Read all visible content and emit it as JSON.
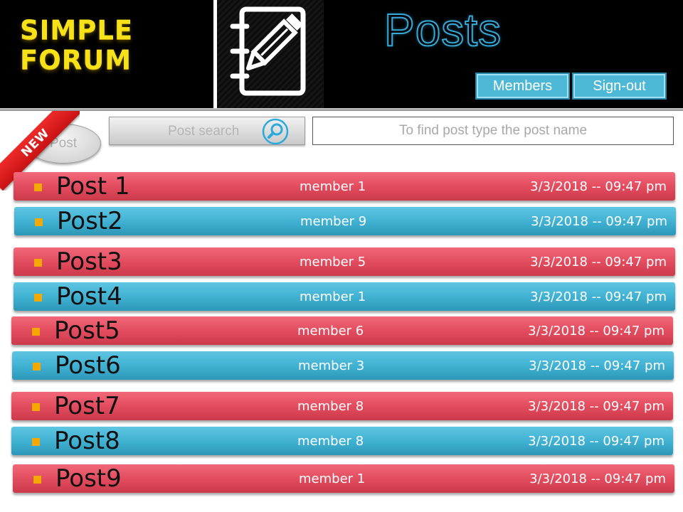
{
  "header": {
    "logo_line1": "SIMPLE",
    "logo_line2": "FORUM",
    "page_title": "Posts",
    "members_label": "Members",
    "signout_label": "Sign-out"
  },
  "toolbar": {
    "new_badge": "NEW",
    "new_post_label": "Post",
    "search_button_label": "Post search",
    "search_placeholder": "To find post type the post name"
  },
  "posts": [
    {
      "title": "Post 1",
      "member": "member 1",
      "date": "3/3/2018 -- 09:47 pm",
      "color": "red"
    },
    {
      "title": "Post2",
      "member": "member 9",
      "date": "3/3/2018 -- 09:47 pm",
      "color": "blue"
    },
    {
      "title": "Post3",
      "member": "member 5",
      "date": "3/3/2018 -- 09:47 pm",
      "color": "red"
    },
    {
      "title": "Post4",
      "member": "member 1",
      "date": "3/3/2018 -- 09:47 pm",
      "color": "blue"
    },
    {
      "title": "Post5",
      "member": "member 6",
      "date": "3/3/2018 -- 09:47 pm",
      "color": "red"
    },
    {
      "title": "Post6",
      "member": "member 3",
      "date": "3/3/2018 -- 09:47 pm",
      "color": "blue"
    },
    {
      "title": "Post7",
      "member": "member 8",
      "date": "3/3/2018 -- 09:47 pm",
      "color": "red"
    },
    {
      "title": "Post8",
      "member": "member 8",
      "date": "3/3/2018 -- 09:47 pm",
      "color": "blue"
    },
    {
      "title": "Post9",
      "member": "member 1",
      "date": "3/3/2018 -- 09:47 pm",
      "color": "red"
    }
  ],
  "icons": {
    "header_icon": "notebook-pencil-icon",
    "search_icon": "magnifier-icon",
    "bullet_icon": "square-bullet-icon"
  },
  "colors": {
    "logo_yellow": "#f7e21a",
    "title_outline": "#37a9d8",
    "nav_button": "#4db8d6",
    "row_red": "#e04a5c",
    "row_blue": "#3fb0d1",
    "bullet_orange": "#f5a900",
    "ribbon_red": "#e01e1e"
  }
}
